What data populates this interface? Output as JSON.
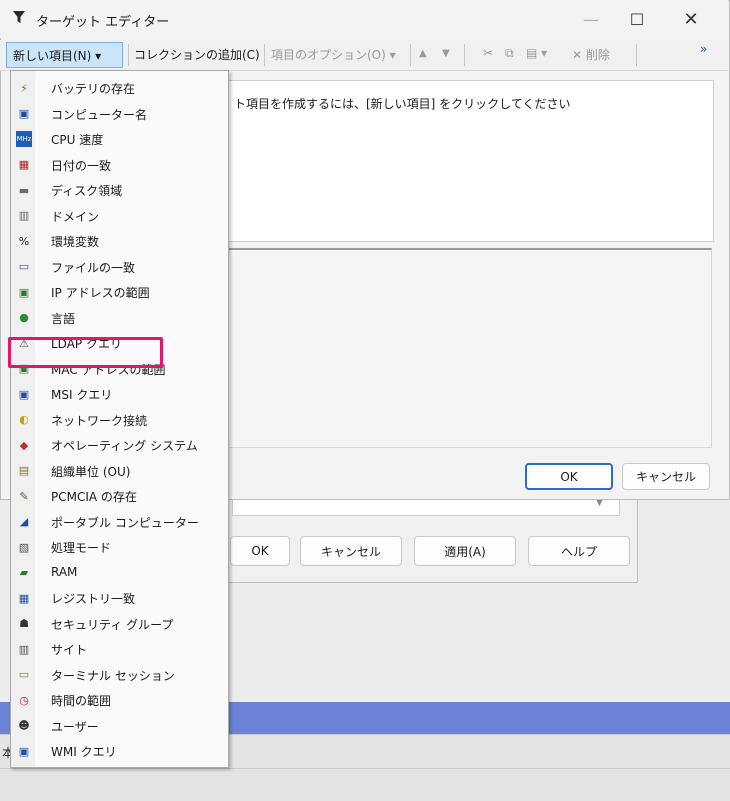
{
  "window": {
    "title": "ターゲット エディター",
    "title_icon": "funnel-icon",
    "controls": {
      "minimize": "—",
      "maximize": "☐",
      "close": "✕"
    }
  },
  "toolbar": {
    "new_item": "新しい項目(N) ▾",
    "add_collection": "コレクションの追加(C)",
    "item_options": "項目のオプション(O) ▾",
    "move_up": "▲",
    "move_down": "▼",
    "cut": "✂",
    "copy": "⧉",
    "paste": "▤ ▾",
    "delete": "✕ 削除",
    "overflow": "»"
  },
  "description_text": "ト項目を作成するには、[新しい項目] をクリックしてください",
  "dialog": {
    "ok": "OK",
    "cancel": "キャンセル"
  },
  "behind_dialog": {
    "ok": "OK",
    "cancel": "キャンセル",
    "apply": "適用(A)",
    "help": "ヘルプ",
    "bottom_text": "本"
  },
  "menu": {
    "highlighted_item": "LDAP クエリ",
    "items": [
      {
        "label": "バッテリの存在",
        "icon": "battery-icon",
        "glyph": "⚡",
        "color": "#5a7d2a"
      },
      {
        "label": "コンピューター名",
        "icon": "computer-icon",
        "glyph": "▣",
        "color": "#1f4ea3"
      },
      {
        "label": "CPU 速度",
        "icon": "cpu-icon",
        "glyph": "MHz",
        "color": "#1d5fb8"
      },
      {
        "label": "日付の一致",
        "icon": "calendar-icon",
        "glyph": "▦",
        "color": "#b02020"
      },
      {
        "label": "ディスク領域",
        "icon": "disk-icon",
        "glyph": "▬",
        "color": "#6a6a6a"
      },
      {
        "label": "ドメイン",
        "icon": "domain-icon",
        "glyph": "▥",
        "color": "#666"
      },
      {
        "label": "環境変数",
        "icon": "env-var-icon",
        "glyph": "%",
        "color": "#222"
      },
      {
        "label": "ファイルの一致",
        "icon": "file-icon",
        "glyph": "▭",
        "color": "#2a5aa8"
      },
      {
        "label": "IP アドレスの範囲",
        "icon": "ip-range-icon",
        "glyph": "▣",
        "color": "#2e7a2e"
      },
      {
        "label": "言語",
        "icon": "globe-icon",
        "glyph": "●",
        "color": "#2a8a3a"
      },
      {
        "label": "LDAP クエリ",
        "icon": "ldap-icon",
        "glyph": "⚠",
        "color": "#555"
      },
      {
        "label": "MAC アドレスの範囲",
        "icon": "mac-range-icon",
        "glyph": "▣",
        "color": "#2e7a2e"
      },
      {
        "label": "MSI クエリ",
        "icon": "msi-icon",
        "glyph": "▣",
        "color": "#1f4ea3"
      },
      {
        "label": "ネットワーク接続",
        "icon": "network-icon",
        "glyph": "◐",
        "color": "#c7a000"
      },
      {
        "label": "オペレーティング システム",
        "icon": "os-icon",
        "glyph": "◆",
        "color": "#c03030"
      },
      {
        "label": "組織単位 (OU)",
        "icon": "ou-icon",
        "glyph": "▤",
        "color": "#8a7a20"
      },
      {
        "label": "PCMCIA の存在",
        "icon": "pcmcia-icon",
        "glyph": "✎",
        "color": "#3a6a3a"
      },
      {
        "label": "ポータブル コンピューター",
        "icon": "laptop-icon",
        "glyph": "◢",
        "color": "#1f4ea3"
      },
      {
        "label": "処理モード",
        "icon": "processing-icon",
        "glyph": "▧",
        "color": "#555"
      },
      {
        "label": "RAM",
        "icon": "ram-icon",
        "glyph": "▰",
        "color": "#2e7a2e"
      },
      {
        "label": "レジストリ一致",
        "icon": "registry-icon",
        "glyph": "▦",
        "color": "#1f4ea3"
      },
      {
        "label": "セキュリティ グループ",
        "icon": "security-group-icon",
        "glyph": "☗",
        "color": "#333"
      },
      {
        "label": "サイト",
        "icon": "site-icon",
        "glyph": "▥",
        "color": "#555"
      },
      {
        "label": "ターミナル セッション",
        "icon": "terminal-icon",
        "glyph": "▭",
        "color": "#8a7a20"
      },
      {
        "label": "時間の範囲",
        "icon": "clock-icon",
        "glyph": "◷",
        "color": "#c02020"
      },
      {
        "label": "ユーザー",
        "icon": "user-icon",
        "glyph": "☻",
        "color": "#333"
      },
      {
        "label": "WMI クエリ",
        "icon": "wmi-icon",
        "glyph": "▣",
        "color": "#1f4ea3"
      }
    ]
  }
}
